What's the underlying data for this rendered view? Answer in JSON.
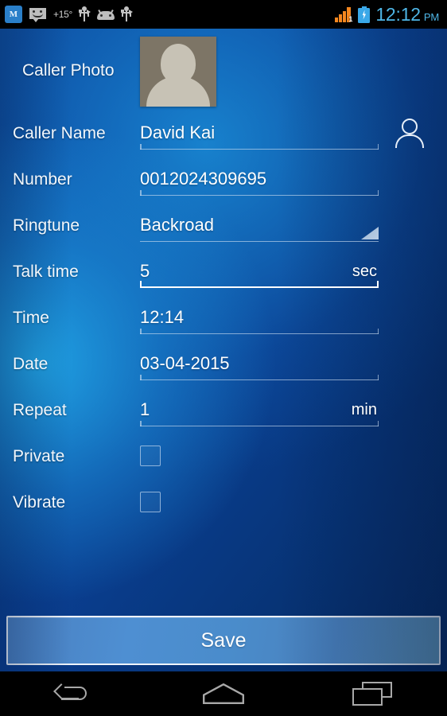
{
  "status_bar": {
    "notification_icons": [
      {
        "name": "app-m-icon",
        "glyph": "M"
      },
      {
        "name": "message-smiley-icon",
        "glyph": "sms"
      },
      {
        "name": "temperature-indicator",
        "glyph": "+15°"
      },
      {
        "name": "usb-icon-1",
        "glyph": "usb"
      },
      {
        "name": "android-robot-icon",
        "glyph": "android"
      },
      {
        "name": "usb-icon-2",
        "glyph": "usb"
      }
    ],
    "temperature": "+15°",
    "signal_sim_label": "1",
    "time": "12:12",
    "ampm": "PM",
    "clock_color": "#4fb7e8",
    "signal_color": "#f5871f",
    "battery_color": "#3aa8e8"
  },
  "form": {
    "photo": {
      "label": "Caller Photo",
      "icon": "avatar-placeholder-icon"
    },
    "fields": [
      {
        "name": "caller-name",
        "label": "Caller Name",
        "value": "David Kai",
        "unit": "",
        "focused": false,
        "trailing_icon": "contact-person-icon"
      },
      {
        "name": "number",
        "label": "Number",
        "value": "0012024309695",
        "unit": "",
        "focused": false,
        "trailing_icon": ""
      },
      {
        "name": "ringtune",
        "label": "Ringtune",
        "value": "Backroad",
        "unit": "",
        "focused": false,
        "trailing_icon": "spinner-dropdown-icon"
      },
      {
        "name": "talk-time",
        "label": "Talk time",
        "value": "5",
        "unit": "sec",
        "focused": true,
        "trailing_icon": ""
      },
      {
        "name": "time",
        "label": "Time",
        "value": "12:14",
        "unit": "",
        "focused": false,
        "trailing_icon": ""
      },
      {
        "name": "date",
        "label": "Date",
        "value": "03-04-2015",
        "unit": "",
        "focused": false,
        "trailing_icon": ""
      },
      {
        "name": "repeat",
        "label": "Repeat",
        "value": "1",
        "unit": "min",
        "focused": false,
        "trailing_icon": ""
      }
    ],
    "checkboxes": [
      {
        "name": "private",
        "label": "Private",
        "checked": false
      },
      {
        "name": "vibrate",
        "label": "Vibrate",
        "checked": false
      }
    ]
  },
  "save": {
    "label": "Save"
  },
  "nav_bar": {
    "back_label": "back-icon",
    "home_label": "home-icon",
    "recents_label": "recents-icon"
  },
  "theme": {
    "background_blue_bright": "#22aaea",
    "background_blue_mid": "#0a3f92",
    "background_blue_dark": "#062a60",
    "text_white": "#ffffff",
    "label_white": "#f2f7fc",
    "underline_idle": "#cedef0",
    "underline_focused": "#ffffff",
    "save_button_border": "#f0f5fb",
    "avatar_bg": "#7d7566",
    "avatar_fg": "#c7c2b5"
  }
}
